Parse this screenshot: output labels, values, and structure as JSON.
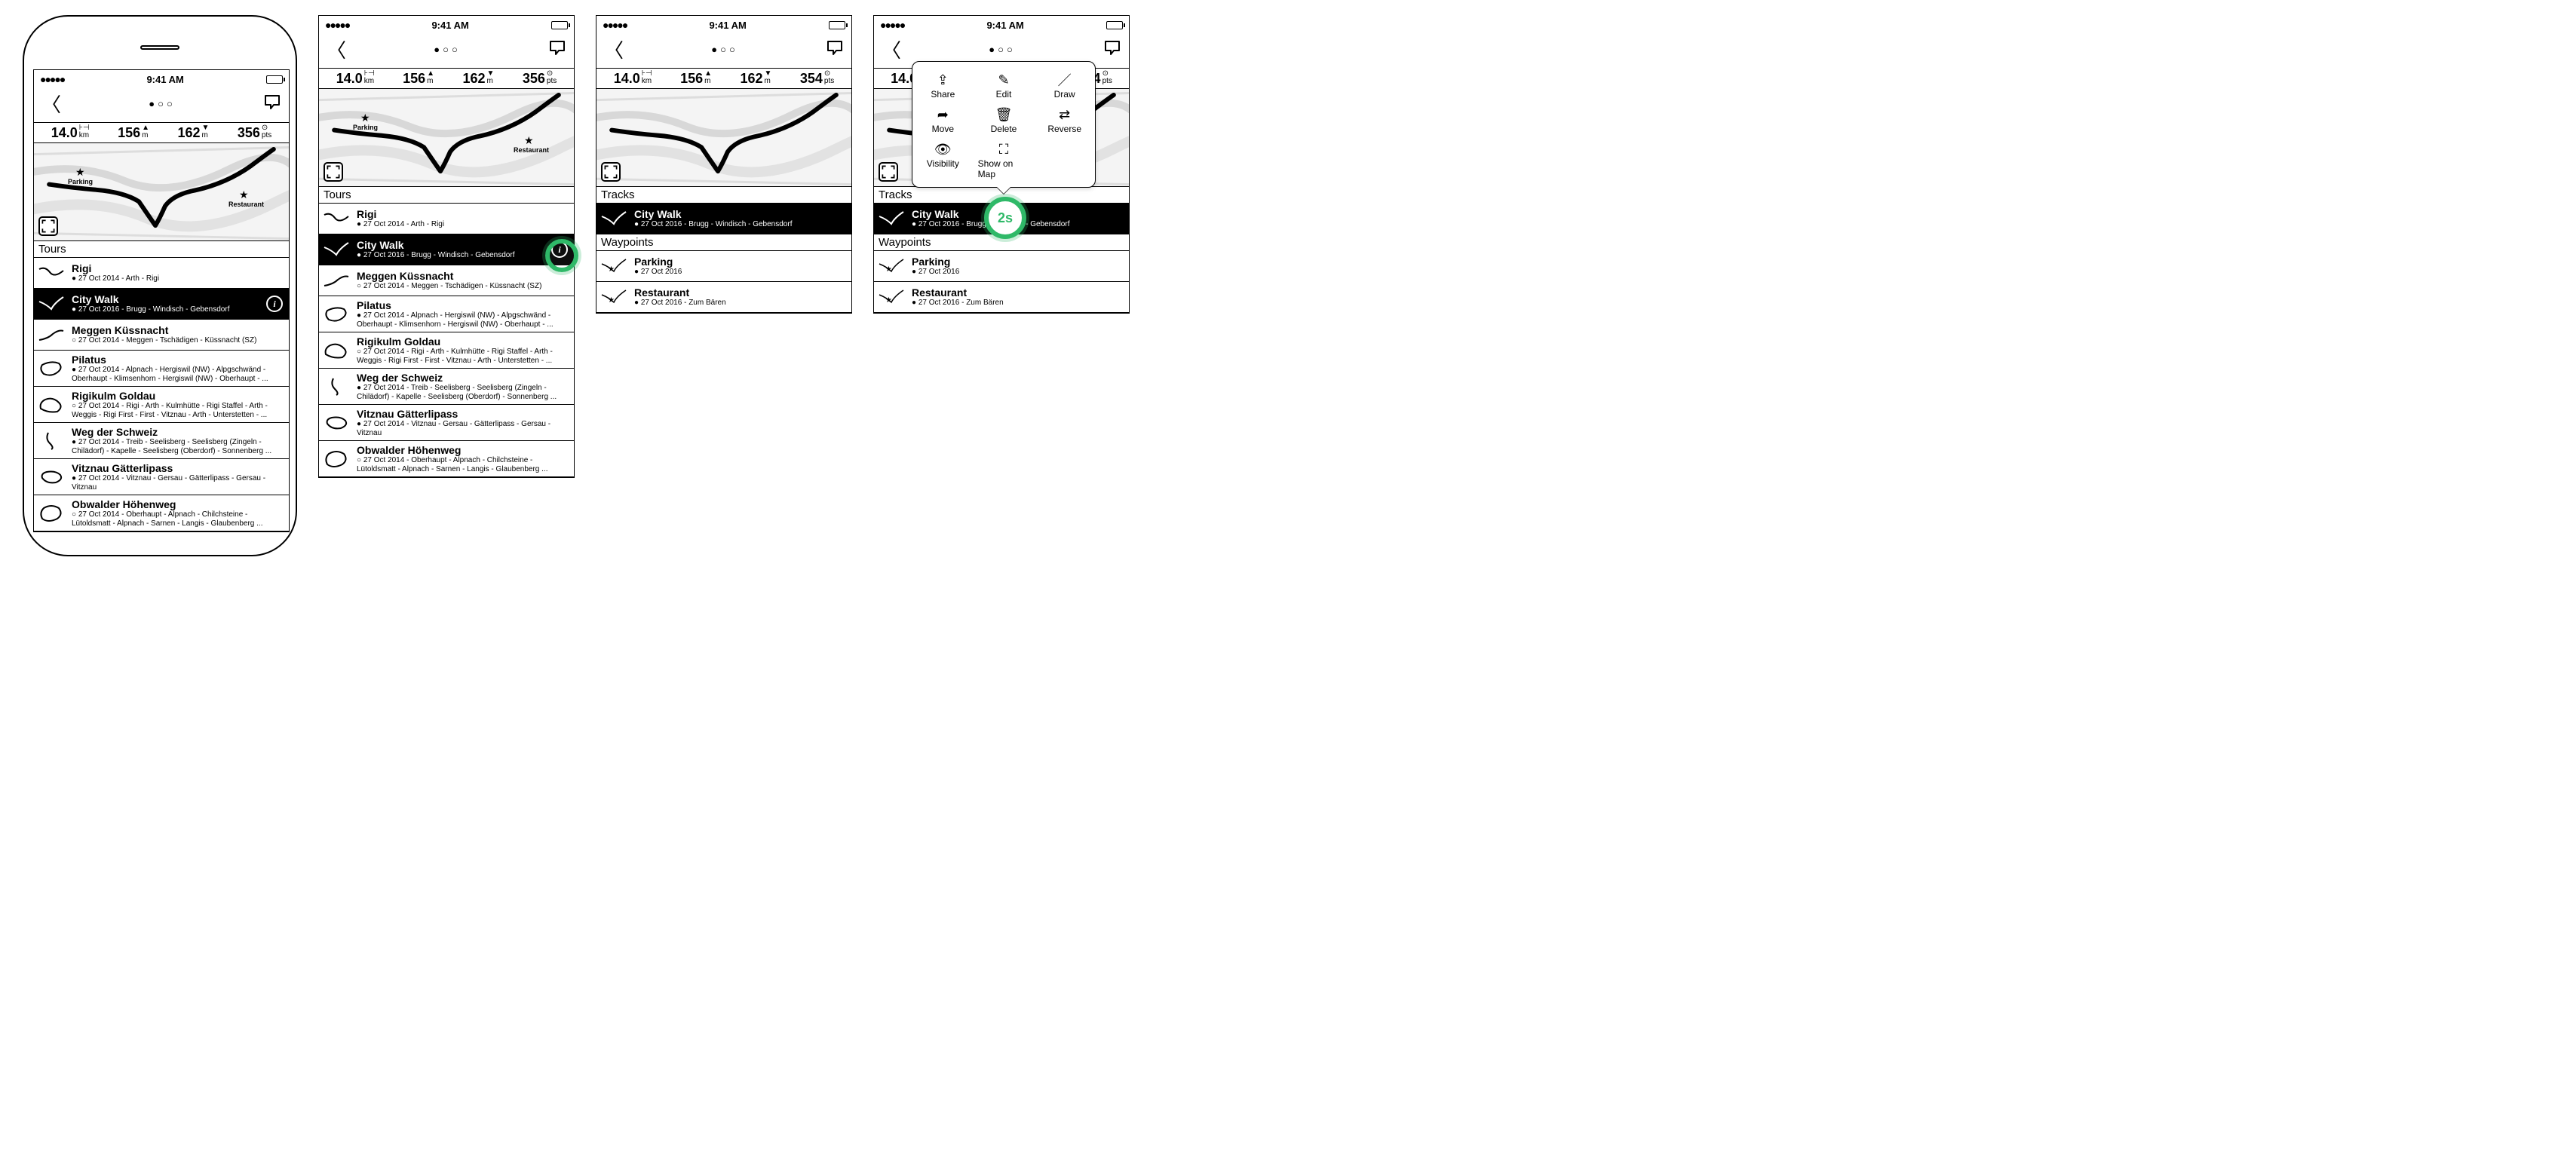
{
  "status": {
    "time": "9:41 AM"
  },
  "stats": {
    "dist": "14.0",
    "dist_unit": "km",
    "asc": "156",
    "asc_unit": "m",
    "desc": "162",
    "desc_unit": "m",
    "pts_a": "356",
    "pts_b": "354",
    "pts_unit": "pts"
  },
  "map": {
    "parking_label": "Parking",
    "restaurant_label": "Restaurant"
  },
  "sections": {
    "tours": "Tours",
    "tracks": "Tracks",
    "waypoints": "Waypoints"
  },
  "tours": [
    {
      "title": "Rigi",
      "sub": "● 27 Oct 2014 - Arth - Rigi"
    },
    {
      "title": "City Walk",
      "sub": "● 27 Oct 2016 - Brugg - Windisch - Gebensdorf"
    },
    {
      "title": "Meggen Küssnacht",
      "sub": "○ 27 Oct 2014 - Meggen - Tschädigen - Küssnacht (SZ)"
    },
    {
      "title": "Pilatus",
      "sub": "● 27 Oct 2014 - Alpnach - Hergiswil (NW) - Alpgschwänd -",
      "sub2": "Oberhaupt - Klimsenhorn - Hergiswil (NW) - Oberhaupt - ..."
    },
    {
      "title": "Rigikulm Goldau",
      "sub": "○ 27 Oct 2014 - Rigi - Arth - Kulmhütte - Rigi Staffel - Arth -",
      "sub2": "Weggis - Rigi First - First - Vitznau - Arth - Unterstetten - ..."
    },
    {
      "title": "Weg der Schweiz",
      "sub": "● 27 Oct 2014 - Treib - Seelisberg - Seelisberg (Zingeln -",
      "sub2": "Chilädorf) - Kapelle - Seelisberg (Oberdorf) - Sonnenberg ..."
    },
    {
      "title": "Vitznau Gätterlipass",
      "sub": "● 27 Oct 2014 - Vitznau - Gersau - Gätterlipass - Gersau -",
      "sub2": "Vitznau"
    },
    {
      "title": "Obwalder Höhenweg",
      "sub": "○ 27 Oct 2014 - Oberhaupt - Alpnach - Chilchsteine -",
      "sub2": "Lütoldsmatt - Alpnach - Sarnen - Langis - Glaubenberg ..."
    }
  ],
  "tracks": [
    {
      "title": "City Walk",
      "sub": "● 27 Oct 2016 - Brugg - Windisch - Gebensdorf"
    }
  ],
  "waypoints": [
    {
      "title": "Parking",
      "sub": "● 27 Oct 2016"
    },
    {
      "title": "Restaurant",
      "sub": "● 27 Oct 2016 - Zum Bären"
    }
  ],
  "popover": {
    "share": "Share",
    "edit": "Edit",
    "draw": "Draw",
    "move": "Move",
    "delete": "Delete",
    "reverse": "Reverse",
    "visibility": "Visibility",
    "show_on_map": "Show on Map"
  },
  "badge": {
    "long_press": "2s"
  }
}
